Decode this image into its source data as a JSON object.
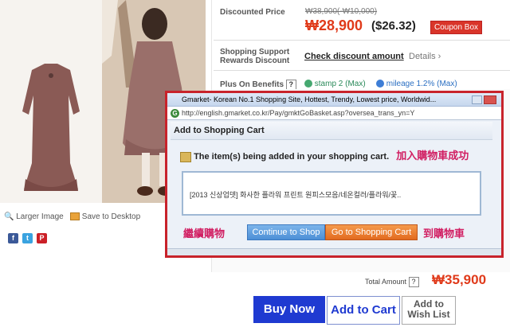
{
  "pricing": {
    "discounted_label": "Discounted Price",
    "original": "₩38,900(-₩10,000)",
    "price": "₩28,900",
    "price_usd": "($26.32)",
    "coupon": "Coupon Box",
    "support_label_1": "Shopping Support",
    "support_label_2": "Rewards Discount",
    "check_discount": "Check discount amount",
    "details": "Details ›",
    "benefits_label": "Plus On Benefits",
    "help": "?",
    "stamp": "stamp 2 (Max)",
    "mileage": "mileage 1.2% (Max)"
  },
  "tools": {
    "larger_image": "Larger Image",
    "save_desktop": "Save to Desktop"
  },
  "popup": {
    "window_title": "Gmarket- Korean No.1 Shopping Site, Hottest, Trendy, Lowest price, Worldwid...",
    "url": "http://english.gmarket.co.kr/Pay/gmktGoBasket.asp?oversea_trans_yn=Y",
    "header": "Add to Shopping Cart",
    "message": "The item(s) being added in your shopping cart.",
    "message_cn": "加入購物車成功",
    "item_name": "[2013 신상업뎃] 화사한 플라워 프린트 원피스모음/네온컬러/플라워/꽃..",
    "continue_cn": "繼續購物",
    "continue_button": "Continue to Shop",
    "goto_button": "Go to Shopping Cart",
    "goto_cn": "到購物車"
  },
  "total": {
    "label": "Total Amount",
    "help": "?",
    "amount": "₩35,900"
  },
  "actions": {
    "buy_now": "Buy Now",
    "add_to_cart": "Add to Cart",
    "wish_line1": "Add to",
    "wish_line2": "Wish List"
  }
}
